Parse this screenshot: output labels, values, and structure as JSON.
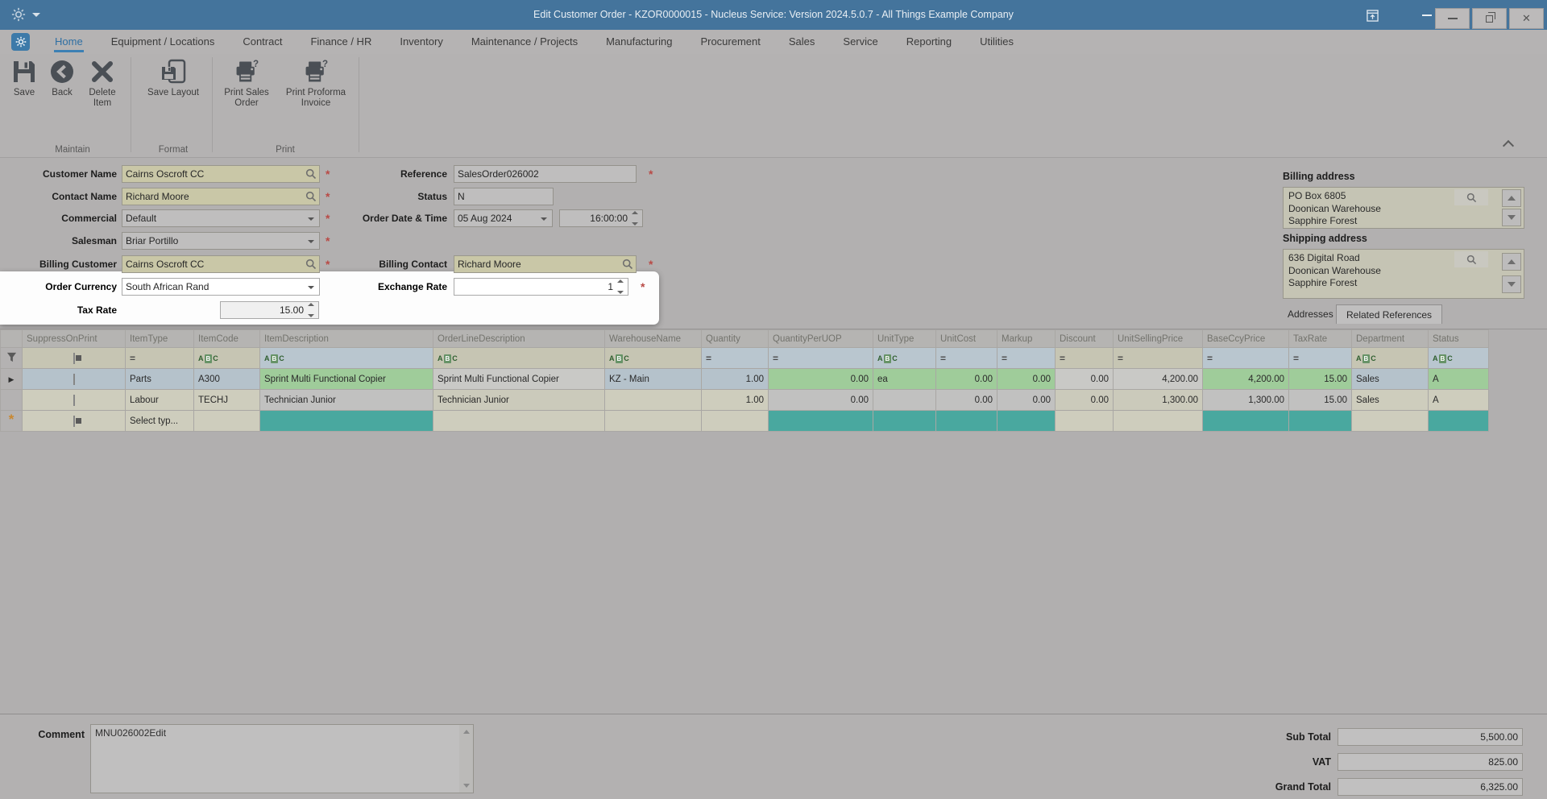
{
  "window": {
    "title": "Edit Customer Order - KZOR0000015 - Nucleus Service: Version 2024.5.0.7 - All Things Example Company"
  },
  "ribbon": {
    "tabs": [
      "Home",
      "Equipment / Locations",
      "Contract",
      "Finance / HR",
      "Inventory",
      "Maintenance / Projects",
      "Manufacturing",
      "Procurement",
      "Sales",
      "Service",
      "Reporting",
      "Utilities"
    ],
    "active_tab": "Home",
    "groups": [
      {
        "label": "Maintain",
        "buttons": [
          "Save",
          "Back",
          "Delete Item"
        ]
      },
      {
        "label": "Format",
        "buttons": [
          "Save Layout"
        ]
      },
      {
        "label": "Print",
        "buttons": [
          "Print Sales Order",
          "Print Proforma Invoice"
        ]
      }
    ]
  },
  "form": {
    "customer_name": {
      "label": "Customer Name",
      "value": "Cairns Oscroft CC"
    },
    "contact_name": {
      "label": "Contact Name",
      "value": "Richard Moore"
    },
    "commercial": {
      "label": "Commercial",
      "value": "Default"
    },
    "salesman": {
      "label": "Salesman",
      "value": "Briar Portillo"
    },
    "billing_customer": {
      "label": "Billing Customer",
      "value": "Cairns Oscroft CC"
    },
    "order_currency": {
      "label": "Order Currency",
      "value": "South African Rand"
    },
    "tax_rate": {
      "label": "Tax Rate",
      "value": "15.00"
    },
    "reference": {
      "label": "Reference",
      "value": "SalesOrder026002"
    },
    "status": {
      "label": "Status",
      "value": "N"
    },
    "order_date_time": {
      "label": "Order Date & Time",
      "date": "05 Aug 2024",
      "time": "16:00:00"
    },
    "billing_contact": {
      "label": "Billing Contact",
      "value": "Richard Moore"
    },
    "exchange_rate": {
      "label": "Exchange Rate",
      "value": "1"
    }
  },
  "addresses": {
    "billing": {
      "label": "Billing address",
      "lines": [
        "PO Box 6805",
        "Doonican Warehouse",
        "Sapphire Forest"
      ]
    },
    "shipping": {
      "label": "Shipping address",
      "lines": [
        "636 Digital Road",
        "Doonican Warehouse",
        "Sapphire Forest"
      ]
    },
    "tabs": [
      "Addresses",
      "Related References"
    ]
  },
  "grid": {
    "columns": [
      "SuppressOnPrint",
      "ItemType",
      "ItemCode",
      "ItemDescription",
      "OrderLineDescription",
      "WarehouseName",
      "Quantity",
      "QuantityPerUOP",
      "UnitType",
      "UnitCost",
      "Markup",
      "Discount",
      "UnitSellingPrice",
      "BaseCcyPrice",
      "TaxRate",
      "Department",
      "Status"
    ],
    "rows": [
      {
        "suppress_on_print": "unchecked",
        "cells": [
          "Parts",
          "A300",
          "Sprint Multi Functional Copier",
          "Sprint Multi Functional Copier",
          "KZ - Main",
          "1.00",
          "0.00",
          "ea",
          "0.00",
          "0.00",
          "0.00",
          "4,200.00",
          "4,200.00",
          "15.00",
          "Sales",
          "A"
        ]
      },
      {
        "suppress_on_print": "unchecked",
        "cells": [
          "Labour",
          "TECHJ",
          "Technician Junior",
          "Technician Junior",
          "",
          "1.00",
          "0.00",
          "",
          "0.00",
          "0.00",
          "0.00",
          "1,300.00",
          "1,300.00",
          "15.00",
          "Sales",
          "A"
        ]
      },
      {
        "suppress_on_print": "indeterminate",
        "cells": [
          "Select typ...",
          "",
          "",
          "",
          "",
          "",
          "",
          "",
          "",
          "",
          "",
          "",
          "",
          "",
          "",
          ""
        ]
      }
    ]
  },
  "footer": {
    "comment": {
      "label": "Comment",
      "value": "MNU026002Edit"
    },
    "totals": [
      {
        "label": "Sub Total",
        "value": "5,500.00"
      },
      {
        "label": "VAT",
        "value": "825.00"
      },
      {
        "label": "Grand Total",
        "value": "6,325.00"
      }
    ]
  },
  "icons": {
    "save": "floppy-disk",
    "back": "circle-left-chevron",
    "delete_item": "x-cross",
    "save_layout": "floppy-on-page",
    "print": "printer-question",
    "lookup": "magnifier",
    "filter": "funnel",
    "gear": "gear"
  },
  "colors": {
    "titlebar": "#44749c",
    "active_tab_accent": "#2e6fa3",
    "required_marker": "#b94a46",
    "spotlight": "#fdfdfd",
    "lookup_field": "#c9c7a7",
    "focused_row_green": "#9fcc9a",
    "focused_row_blue": "#b5c2cb",
    "new_row_teal": "#49a89f"
  }
}
